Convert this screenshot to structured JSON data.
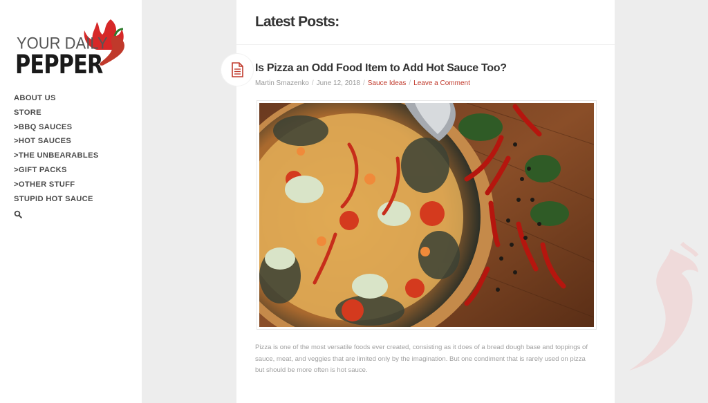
{
  "brand": {
    "logo_line1": "YOUR DAILY",
    "logo_line2": "PEPPER",
    "accent_color": "#c0392b"
  },
  "nav": {
    "items": [
      {
        "label": "ABOUT US"
      },
      {
        "label": "STORE"
      },
      {
        "label": ">BBQ SAUCES"
      },
      {
        "label": ">HOT SAUCES"
      },
      {
        "label": ">THE UNBEARABLES"
      },
      {
        "label": ">GIFT PACKS"
      },
      {
        "label": ">OTHER STUFF"
      },
      {
        "label": "STUPID HOT SAUCE"
      }
    ],
    "search_icon": "search-icon"
  },
  "main": {
    "heading": "Latest Posts:",
    "post": {
      "icon": "document-icon",
      "title": "Is Pizza an Odd Food Item to Add Hot Sauce Too?",
      "author": "Martin Smazenko",
      "date": "June 12, 2018",
      "category": "Sauce Ideas",
      "comment_link": "Leave a Comment",
      "excerpt": "Pizza is one of the most versatile foods ever created, consisting as it does of a bread dough base and toppings of sauce, meat, and veggies that are limited only by the imagination. But one condiment that is rarely used on pizza but should be more often is hot sauce."
    }
  }
}
